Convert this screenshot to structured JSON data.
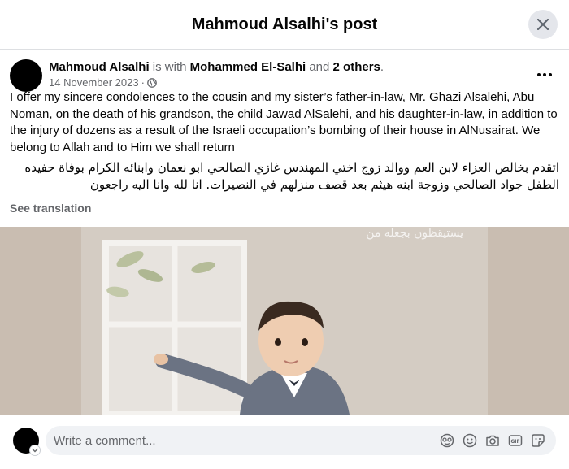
{
  "modal": {
    "title": "Mahmoud Alsalhi's post"
  },
  "post": {
    "author": "Mahmoud Alsalhi",
    "with_text": " is with ",
    "tagged": "Mohammed El-Salhi",
    "and_text": " and ",
    "others": "2 others",
    "period": ".",
    "date": "14 November 2023",
    "separator": " · ",
    "text_en": "I offer my sincere condolences to the cousin and my sister’s father-in-law, Mr. Ghazi Alsalehi, Abu Noman, on the death of his grandson, the child Jawad AlSalehi, and his daughter-in-law, in addition to the injury of dozens as a result of the Israeli occupation’s bombing of their house in AlNusairat. We belong to Allah and to Him we shall return",
    "text_ar": "اتقدم بخالص العزاء لابن العم ووالد زوج اختي المهندس غازي الصالحي ابو نعمان وابنائه الكرام بوفاة حفيده الطفل جواد الصالحي وزوجة ابنه هيثم بعد قصف منزلهم في النصيرات. انا لله وانا اليه راجعون",
    "see_translation": "See translation",
    "image_caption_overlay": "يستيقظون بجعله من"
  },
  "comment": {
    "placeholder": "Write a comment..."
  },
  "icons": {
    "close": "close-icon",
    "more": "more-options-icon",
    "privacy": "globe-icon",
    "avatar_sticker": "avatar-sticker-icon",
    "emoji": "emoji-icon",
    "camera": "camera-icon",
    "gif": "gif-icon",
    "sticker": "sticker-icon"
  },
  "colors": {
    "primary_text": "#050505",
    "secondary_text": "#65676b",
    "input_bg": "#f0f2f5",
    "button_bg": "#e4e6eb"
  }
}
